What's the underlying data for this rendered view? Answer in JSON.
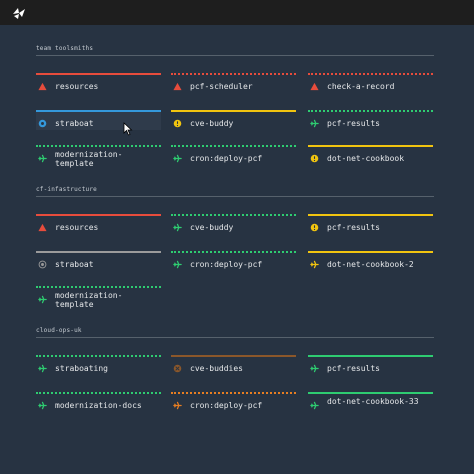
{
  "colors": {
    "failed": "#e74c3c",
    "succeeded": "#2ecc71",
    "pending": "#9b9b9b",
    "aborted": "#8b572a",
    "paused": "#3498db",
    "errored": "#e67e22",
    "started": "#f1c40f"
  },
  "teams": [
    {
      "name": "team toolsmiths",
      "pipelines": [
        {
          "name": "resources",
          "status": "failed",
          "icon": "failed-triangle-icon"
        },
        {
          "name": "pcf-scheduler",
          "status": "failed",
          "running": true,
          "icon": "failed-triangle-icon"
        },
        {
          "name": "check-a-record",
          "status": "failed",
          "running": true,
          "icon": "failed-triangle-icon"
        },
        {
          "name": "straboat",
          "status": "paused",
          "icon": "paused-icon"
        },
        {
          "name": "cve-buddy",
          "status": "started",
          "icon": "pending-clock-icon"
        },
        {
          "name": "pcf-results",
          "status": "succeeded",
          "running": true,
          "icon": "airplane-icon"
        },
        {
          "name": "modernization-template",
          "status": "succeeded",
          "running": true,
          "icon": "airplane-icon"
        },
        {
          "name": "cron:deploy-pcf",
          "status": "succeeded",
          "running": true,
          "icon": "airplane-icon"
        },
        {
          "name": "dot-net-cookbook",
          "status": "started",
          "icon": "pending-clock-icon"
        }
      ]
    },
    {
      "name": "cf-infastructure",
      "pipelines": [
        {
          "name": "resources",
          "status": "failed",
          "icon": "failed-triangle-icon"
        },
        {
          "name": "cve-buddy",
          "status": "succeeded",
          "running": true,
          "icon": "airplane-icon"
        },
        {
          "name": "pcf-results",
          "status": "started",
          "icon": "pending-clock-icon"
        },
        {
          "name": "straboat",
          "status": "pending",
          "icon": "pending-icon"
        },
        {
          "name": "cron:deploy-pcf",
          "status": "succeeded",
          "running": true,
          "icon": "airplane-icon"
        },
        {
          "name": "dot-net-cookbook-2",
          "status": "started",
          "icon": "airplane-icon"
        },
        {
          "name": "modernization-template",
          "status": "succeeded",
          "running": true,
          "icon": "airplane-icon"
        }
      ]
    },
    {
      "name": "cloud-ops-uk",
      "pipelines": [
        {
          "name": "straboating",
          "status": "succeeded",
          "running": true,
          "icon": "airplane-icon"
        },
        {
          "name": "cve-buddies",
          "status": "aborted",
          "icon": "aborted-icon"
        },
        {
          "name": "pcf-results",
          "status": "succeeded",
          "icon": "airplane-icon"
        },
        {
          "name": "modernization-docs",
          "status": "succeeded",
          "running": true,
          "icon": "airplane-icon"
        },
        {
          "name": "cron:deploy-pcf",
          "status": "errored",
          "running": true,
          "icon": "airplane-icon"
        },
        {
          "name": "dot-net-cookbook-33",
          "status": "succeeded",
          "icon": "airplane-icon"
        }
      ]
    }
  ]
}
